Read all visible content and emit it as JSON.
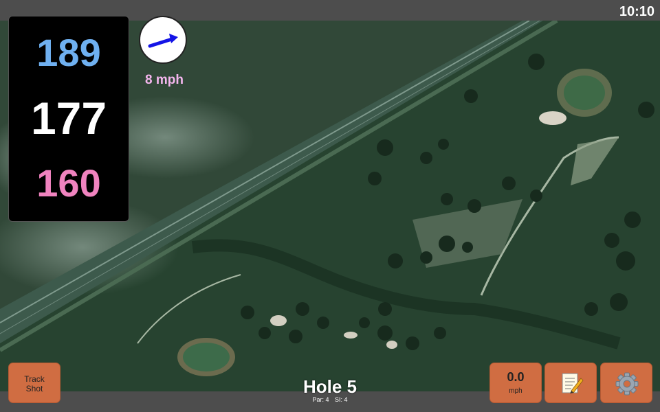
{
  "status": {
    "clock": "10:10"
  },
  "distances": {
    "back": "189",
    "center": "177",
    "front": "160"
  },
  "wind": {
    "speed": "8 mph",
    "icon": "wind-arrow-icon"
  },
  "buttons": {
    "track_shot_line1": "Track",
    "track_shot_line2": "Shot",
    "speed_value": "0.0",
    "speed_unit": "mph",
    "notes_icon": "notepad-icon",
    "settings_icon": "gear-icon"
  },
  "hole": {
    "title": "Hole 5",
    "par": "Par: 4",
    "si": "SI: 4"
  },
  "colors": {
    "back": "#6fb0f0",
    "center": "#ffffff",
    "front": "#f083bf",
    "wind_text": "#f5b6ef",
    "button": "#d06d42"
  }
}
